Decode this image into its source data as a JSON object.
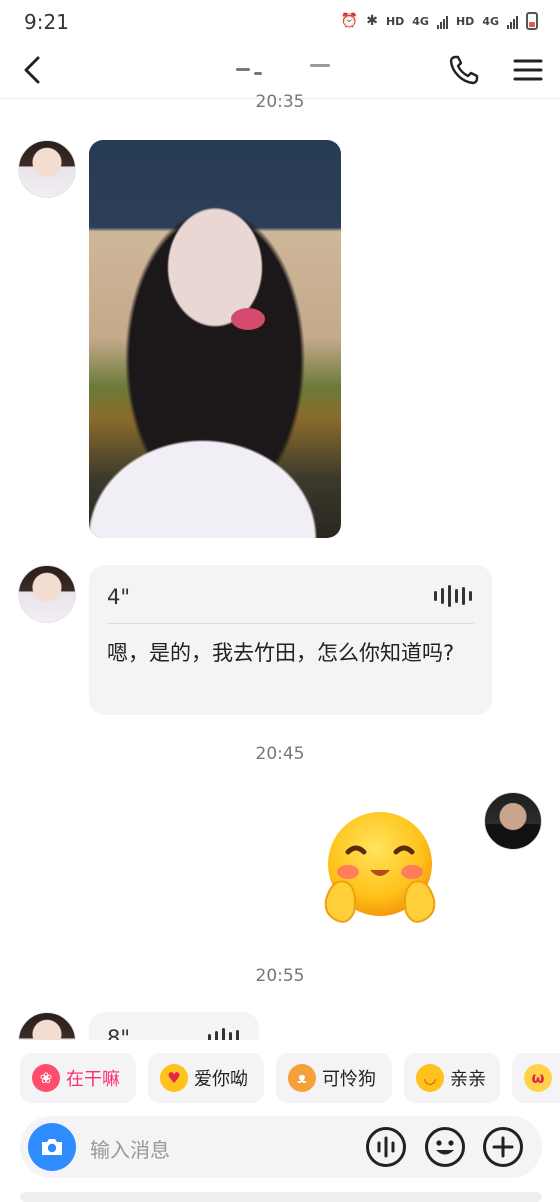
{
  "status_bar": {
    "time": "9:21",
    "hd1": "HD",
    "net1": "4G",
    "hd2": "HD",
    "net2": "4G"
  },
  "header": {
    "back_icon": "chevron-left-icon",
    "phone_icon": "phone-icon",
    "menu_icon": "menu-icon"
  },
  "messages": {
    "ts1": "20:35",
    "voice1": {
      "duration": "4\"",
      "transcript": "嗯，是的，我去竹田，怎么你知道吗?"
    },
    "ts2": "20:45",
    "ts3": "20:55",
    "voice2": {
      "duration": "8\""
    }
  },
  "quick_replies": [
    {
      "label": "在干嘛",
      "color": "#ff2d6f"
    },
    {
      "label": "爱你呦",
      "color": "#222222"
    },
    {
      "label": "可怜狗",
      "color": "#222222"
    },
    {
      "label": "亲亲",
      "color": "#222222"
    }
  ],
  "input": {
    "placeholder": "输入消息"
  },
  "colors": {
    "accent_blue": "#2f8cff",
    "bubble_bg": "#f4f4f6",
    "quick_pink": "#ff2d6f"
  }
}
